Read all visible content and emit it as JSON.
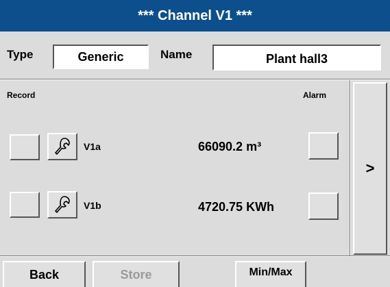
{
  "title_bar": {
    "text": "*** Channel V1 ***"
  },
  "header": {
    "type_label": "Type",
    "type_value": "Generic",
    "name_label": "Name",
    "name_value": "Plant hall3"
  },
  "panel": {
    "record_label": "Record",
    "alarm_label": "Alarm",
    "rows": [
      {
        "label": "V1a",
        "value": "66090.2 m³"
      },
      {
        "label": "V1b",
        "value": "4720.75 KWh"
      }
    ],
    "next_label": ">"
  },
  "icons": {
    "settings": "wrench-icon"
  },
  "footer": {
    "back_label": "Back",
    "store_label": "Store",
    "minmax_label": "Min/Max"
  },
  "colors": {
    "title_bar_bg": "#0d4f8c",
    "screen_bg": "#dcdcdc",
    "disabled_text": "#9a9a9a"
  }
}
